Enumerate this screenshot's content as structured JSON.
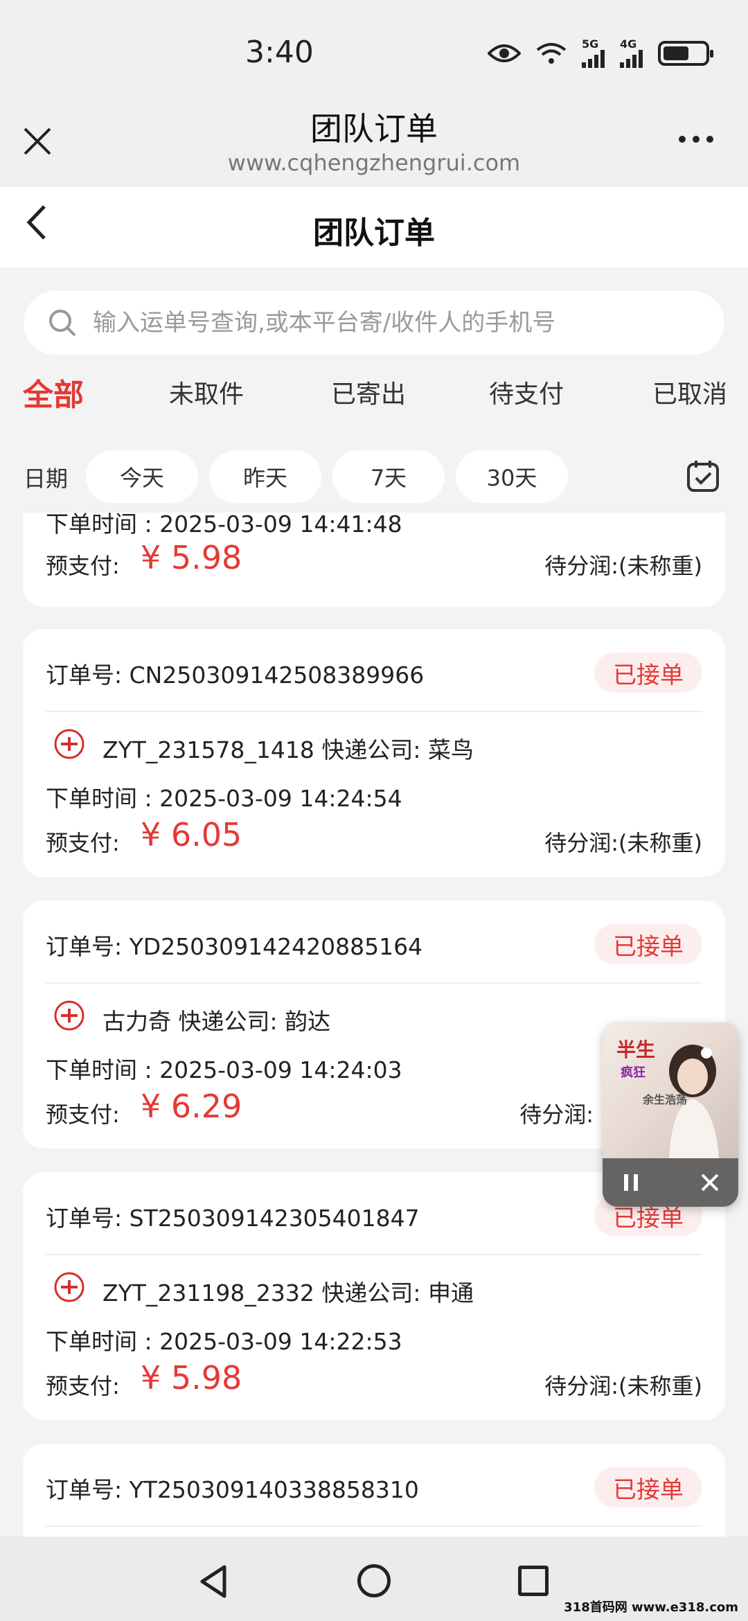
{
  "status_bar": {
    "time": "3:40",
    "net1": "5G",
    "net2": "4G",
    "battery_level": 0.55
  },
  "browser": {
    "title": "团队订单",
    "url": "www.cqhengzhengrui.com"
  },
  "app": {
    "title": "团队订单"
  },
  "search": {
    "placeholder": "输入运单号查询,或本平台寄/收件人的手机号"
  },
  "tabs": [
    {
      "label": "全部",
      "active": true
    },
    {
      "label": "未取件",
      "active": false
    },
    {
      "label": "已寄出",
      "active": false
    },
    {
      "label": "待支付",
      "active": false
    },
    {
      "label": "已取消",
      "active": false
    }
  ],
  "date_filter": {
    "label": "日期",
    "chips": [
      "今天",
      "昨天",
      "7天",
      "30天"
    ]
  },
  "orders_partial": {
    "time_line": "下单时间 : 2025-03-09 14:41:48",
    "pay_label": "预支付:",
    "price": "¥ 5.98",
    "pending": "待分润:(未称重)"
  },
  "orders": [
    {
      "order_label": "订单号:",
      "order_no": "CN250309142508389966",
      "status": "已接单",
      "sender": "ZYT_231578_1418",
      "courier_label": "快递公司:",
      "courier": "菜鸟",
      "time_line": "下单时间 : 2025-03-09 14:24:54",
      "pay_label": "预支付:",
      "price": "¥ 6.05",
      "pending": "待分润:(未称重)"
    },
    {
      "order_label": "订单号:",
      "order_no": "YD250309142420885164",
      "status": "已接单",
      "sender": "古力奇",
      "courier_label": "快递公司:",
      "courier": "韵达",
      "time_line": "下单时间 : 2025-03-09 14:24:03",
      "pay_label": "预支付:",
      "price": "¥ 6.29",
      "pending": "待分润:"
    },
    {
      "order_label": "订单号:",
      "order_no": "ST250309142305401847",
      "status": "已接单",
      "sender": "ZYT_231198_2332",
      "courier_label": "快递公司:",
      "courier": "申通",
      "time_line": "下单时间 : 2025-03-09 14:22:53",
      "pay_label": "预支付:",
      "price": "¥ 5.98",
      "pending": "待分润:(未称重)"
    },
    {
      "order_label": "订单号:",
      "order_no": "YT250309140338858310",
      "status": "已接单"
    }
  ],
  "player": {
    "art_text_1": "半生",
    "art_text_2": "疯狂",
    "art_text_3": "余生浩荡"
  },
  "watermark": "318首码网 www.e318.com",
  "colors": {
    "accent": "#e53935",
    "status_bg": "#fdeeee",
    "page_bg": "#f3f3f3"
  }
}
